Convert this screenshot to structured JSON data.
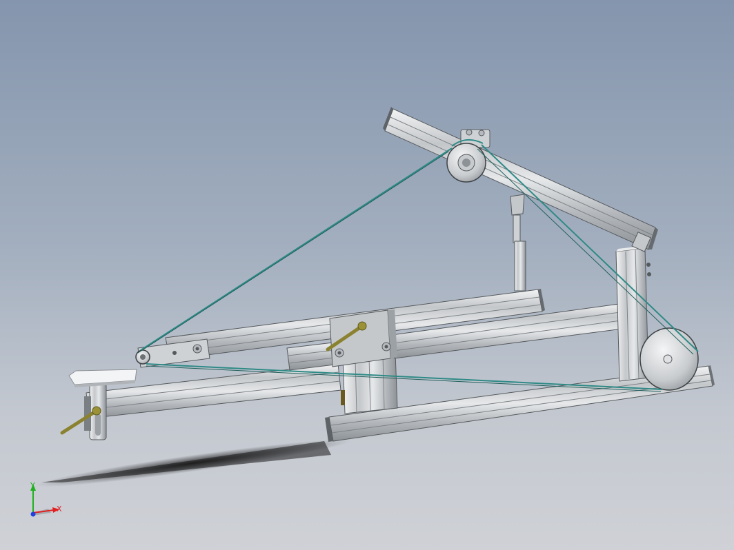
{
  "viewport": {
    "title": "",
    "background_top": "#8495ad",
    "background_bottom": "#cfd1d6"
  },
  "colors": {
    "extrusion_face": "#c9cccf",
    "extrusion_light": "#eef0f1",
    "extrusion_dark": "#6f7478",
    "belt": "#2e8a86",
    "handle": "#8a8230",
    "shadow": "#2a2a2a"
  },
  "triad": {
    "x_label": "X",
    "y_label": "Y",
    "x_color": "#e02020",
    "y_color": "#20b020",
    "z_color": "#2040e0"
  }
}
